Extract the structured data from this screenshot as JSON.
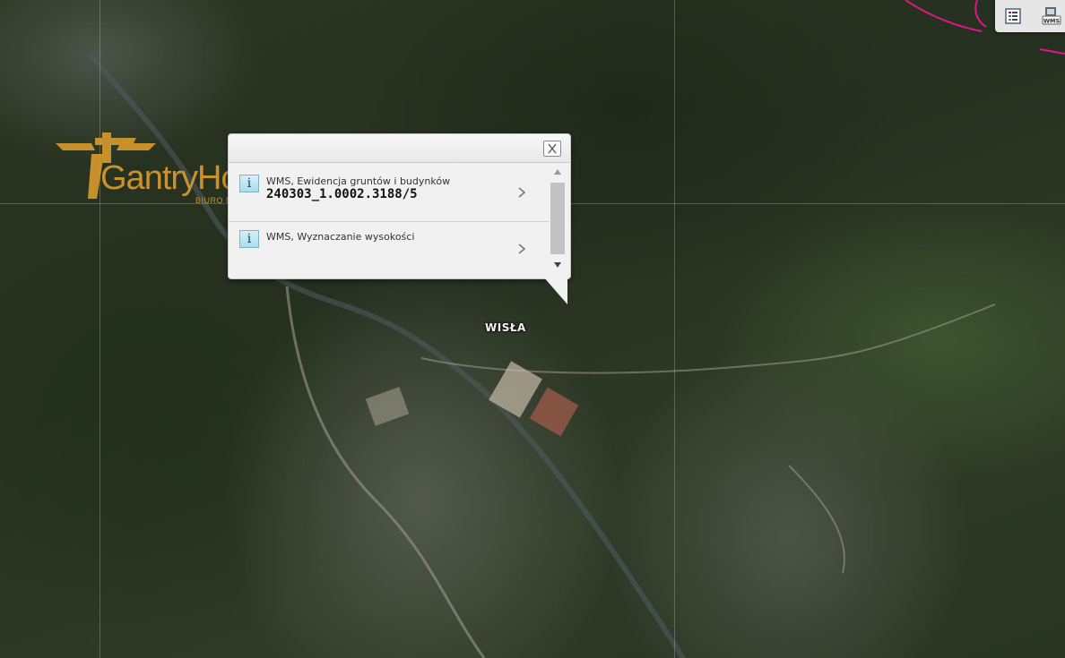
{
  "map": {
    "place_label": "WISŁA",
    "watermark": {
      "name": "GantryHouse",
      "subtitle": "BIURO NIERUCHOMOŚCI",
      "brand_color": "#d99a2b"
    },
    "boundary_color": "#e0188a"
  },
  "toolbar": {
    "legend_icon": "layer-list-icon",
    "wms_icon": "wms-layers-icon",
    "wms_label": "WMS"
  },
  "popup": {
    "results": [
      {
        "icon": "info-icon",
        "icon_glyph": "i",
        "title": "WMS, Ewidencja gruntów i budynków",
        "value": "240303_1.0002.3188/5"
      },
      {
        "icon": "info-icon",
        "icon_glyph": "i",
        "title": "WMS, Wyznaczanie wysokości"
      }
    ]
  }
}
